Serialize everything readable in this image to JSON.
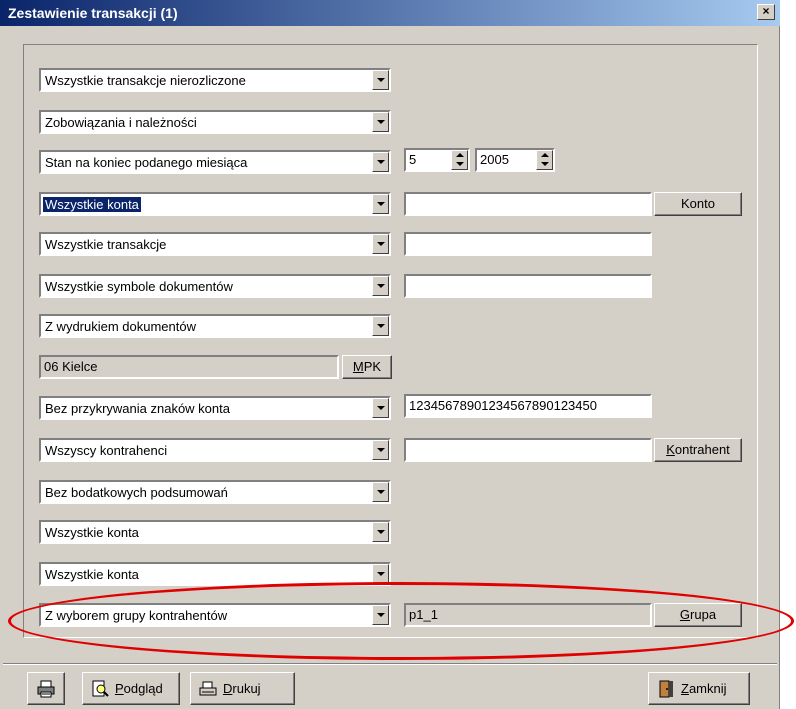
{
  "window": {
    "title": "Zestawienie transakcji (1)",
    "close_label": "×"
  },
  "rows": {
    "r1": {
      "combo": "Wszystkie transakcje nierozliczone"
    },
    "r2": {
      "combo": "Zobowiązania i należności"
    },
    "r3": {
      "combo": "Stan na koniec podanego miesiąca",
      "month": "5",
      "year": "2005"
    },
    "r4": {
      "combo": "Wszystkie konta",
      "field": "",
      "button": "Konto"
    },
    "r5": {
      "combo": "Wszystkie transakcje",
      "field": ""
    },
    "r6": {
      "combo": "Wszystkie symbole dokumentów",
      "field": ""
    },
    "r7": {
      "combo": "Z wydrukiem dokumentów"
    },
    "r8": {
      "field": "06  Kielce",
      "button_u": "M",
      "button_rest": "PK"
    },
    "r9": {
      "combo": "Bez przykrywania znaków konta",
      "field": "12345678901234567890123450"
    },
    "r10": {
      "combo": "Wszyscy kontrahenci",
      "field": "",
      "button_u": "K",
      "button_rest": "ontrahent"
    },
    "r11": {
      "combo": "Bez bodatkowych podsumowań"
    },
    "r12": {
      "combo": "Wszystkie konta"
    },
    "r13": {
      "combo": "Wszystkie konta"
    },
    "r14": {
      "combo": "Z wyborem grupy kontrahentów",
      "field": "p1_1",
      "button_u": "G",
      "button_rest": "rupa"
    }
  },
  "footer": {
    "preview_u": "P",
    "preview_rest": "odgląd",
    "print_u": "D",
    "print_rest": "rukuj",
    "close_u": "Z",
    "close_rest": "amknij"
  },
  "icons": {
    "printer": "printer-icon",
    "preview": "magnifier-icon",
    "print": "print-icon",
    "exit": "door-icon"
  },
  "colors": {
    "titlebar_start": "#0a246a",
    "titlebar_end": "#a6caf0",
    "highlight": "#e00000",
    "face": "#d4d0c8"
  }
}
